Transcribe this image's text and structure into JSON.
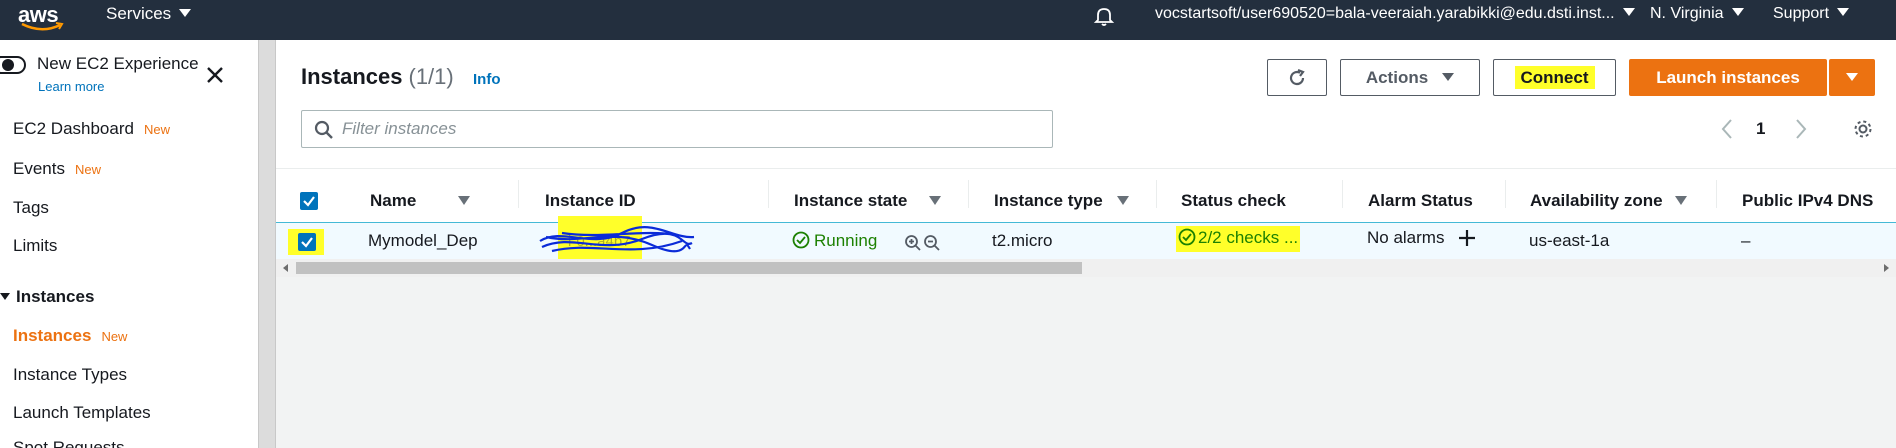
{
  "topnav": {
    "logo": "aws",
    "services": "Services",
    "account": "vocstartsoft/user690520=bala-veeraiah.yarabikki@edu.dsti.inst...",
    "region": "N. Virginia",
    "support": "Support"
  },
  "sidebar": {
    "experience_title": "New EC2 Experience",
    "learn_more": "Learn more",
    "items": [
      {
        "label": "EC2 Dashboard",
        "badge": "New"
      },
      {
        "label": "Events",
        "badge": "New"
      },
      {
        "label": "Tags"
      },
      {
        "label": "Limits"
      }
    ],
    "section": "Instances",
    "section_items": [
      {
        "label": "Instances",
        "badge": "New",
        "active": true
      },
      {
        "label": "Instance Types"
      },
      {
        "label": "Launch Templates"
      },
      {
        "label": "Spot Requests"
      }
    ]
  },
  "main": {
    "title": "Instances",
    "count": "(1/1)",
    "info": "Info",
    "buttons": {
      "refresh_icon": "refresh-icon",
      "actions": "Actions",
      "connect": "Connect",
      "launch": "Launch instances"
    },
    "filter_placeholder": "Filter instances",
    "page": "1"
  },
  "table": {
    "columns": [
      "Name",
      "Instance ID",
      "Instance state",
      "Instance type",
      "Status check",
      "Alarm Status",
      "Availability zone",
      "Public IPv4 DNS"
    ],
    "rows": [
      {
        "name": "Mymodel_Dep",
        "instance_id": "i-0...a4b7",
        "state": "Running",
        "type": "t2.micro",
        "status_check": "2/2 checks ...",
        "alarm": "No alarms",
        "zone": "us-east-1a",
        "dns": "–"
      }
    ]
  },
  "colors": {
    "nav_bg": "#232f3e",
    "primary": "#ec7211",
    "link": "#0073bb",
    "running": "#1d8102",
    "highlight": "#ffff2a",
    "scribble": "#0a2bd8"
  }
}
